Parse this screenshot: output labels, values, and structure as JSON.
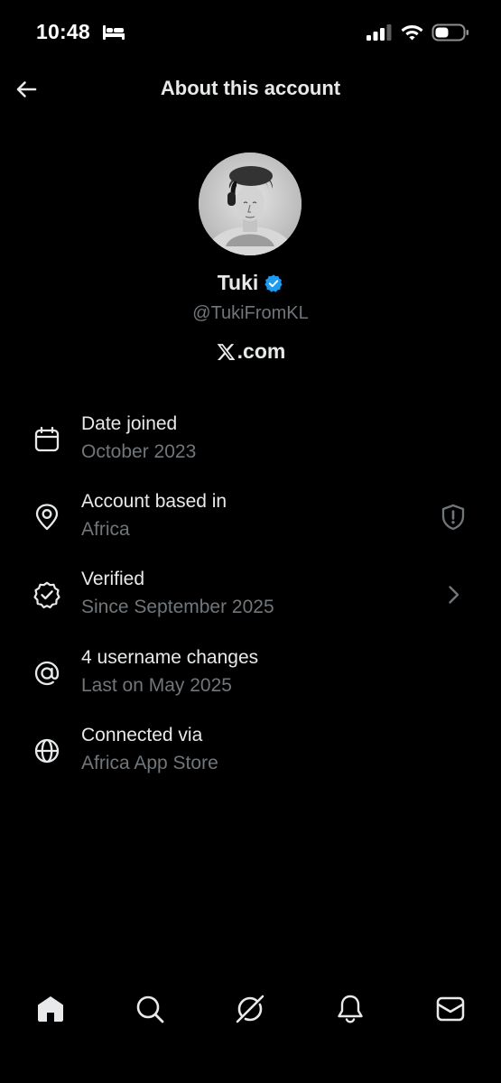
{
  "status_bar": {
    "time": "10:48",
    "focus_mode_icon": "bed-icon",
    "signal_icon": "cellular-signal-icon",
    "wifi_icon": "wifi-icon",
    "battery_icon": "battery-icon"
  },
  "header": {
    "back_icon": "back-arrow-icon",
    "title": "About this account"
  },
  "profile": {
    "display_name": "Tuki",
    "verified_icon": "verified-badge-icon",
    "username": "@TukiFromKL",
    "site": ".com",
    "site_logo": "x-logo-icon"
  },
  "details": [
    {
      "icon": "calendar-icon",
      "title": "Date joined",
      "subtitle": "October 2023"
    },
    {
      "icon": "location-pin-icon",
      "title": "Account based in",
      "subtitle": "Africa",
      "trailing_icon": "shield-alert-icon"
    },
    {
      "icon": "verified-seal-icon",
      "title": "Verified",
      "subtitle": "Since September 2025",
      "trailing_icon": "chevron-right-icon"
    },
    {
      "icon": "at-sign-icon",
      "title": "4 username changes",
      "subtitle": "Last on May 2025"
    },
    {
      "icon": "globe-icon",
      "title": "Connected via",
      "subtitle": "Africa App Store"
    }
  ],
  "bottom_nav": [
    {
      "icon": "home-icon",
      "active": true
    },
    {
      "icon": "search-icon"
    },
    {
      "icon": "grok-icon"
    },
    {
      "icon": "notifications-bell-icon"
    },
    {
      "icon": "messages-envelope-icon"
    }
  ],
  "colors": {
    "background": "#000000",
    "primary_text": "#e7e9ea",
    "secondary_text": "#71767b",
    "verified_blue": "#1d9bf0"
  }
}
